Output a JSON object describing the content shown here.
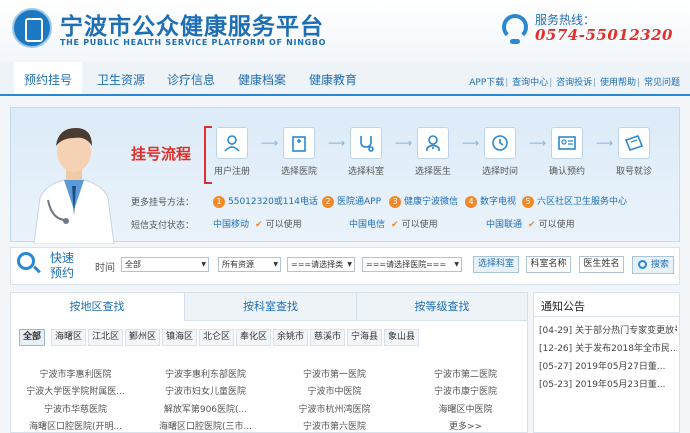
{
  "header": {
    "title": "宁波市公众健康服务平台",
    "subtitle": "THE PUBLIC HEALTH SERVICE PLATFORM OF NINGBO",
    "hotline_label": "服务热线：",
    "hotline_number": "0574-55012320"
  },
  "nav": {
    "items": [
      "预约挂号",
      "卫生资源",
      "诊疗信息",
      "健康档案",
      "健康教育"
    ],
    "quick_links": [
      "APP下载",
      "查询中心",
      "咨询投诉",
      "使用帮助",
      "常见问题"
    ]
  },
  "process": {
    "title": "挂号流程",
    "steps": [
      "用户注册",
      "选择医院",
      "选择科室",
      "选择医生",
      "选择时间",
      "确认预约",
      "取号就诊"
    ],
    "more_label": "更多挂号方法：",
    "methods": [
      {
        "num": "1",
        "text": "55012320或114电话"
      },
      {
        "num": "2",
        "text": "医院通APP"
      },
      {
        "num": "3",
        "text": "健康宁波微信"
      },
      {
        "num": "4",
        "text": "数字电视"
      },
      {
        "num": "5",
        "text": "六区社区卫生服务中心"
      }
    ],
    "sms_label": "短信支付状态：",
    "carriers": [
      {
        "name": "中国移动",
        "status": "可以使用"
      },
      {
        "name": "中国电信",
        "status": "可以使用"
      },
      {
        "name": "中国联通",
        "status": "可以使用"
      }
    ]
  },
  "quick_search": {
    "title": "快速预约",
    "time_label": "时间",
    "time_value": "全部",
    "resource_value": "所有资源",
    "type_value": "===请选择类",
    "hospital_value": "===请选择医院===",
    "dept_button": "选择科室",
    "dept_input": "科室名称",
    "doctor_input": "医生姓名",
    "search_button": "搜索"
  },
  "search_tabs": [
    "按地区查找",
    "按科室查找",
    "按等级查找"
  ],
  "districts": [
    "全部",
    "海曙区",
    "江北区",
    "鄞州区",
    "镇海区",
    "北仑区",
    "奉化区",
    "余姚市",
    "慈溪市",
    "宁海县",
    "象山县"
  ],
  "hospitals": [
    [
      "宁波市李惠利医院",
      "宁波李惠利东部医院",
      "宁波市第一医院",
      "宁波市第二医院"
    ],
    [
      "宁波大学医学院附属医...",
      "宁波市妇女儿童医院",
      "宁波市中医院",
      "宁波市康宁医院"
    ],
    [
      "宁波市华慈医院",
      "解放军第906医院(...",
      "宁波市杭州湾医院",
      "海曙区中医院"
    ],
    [
      "海曙区口腔医院(开明...",
      "海曙区口腔医院(三市...",
      "宁波市第六医院",
      "更多>>"
    ]
  ],
  "notices": {
    "title": "通知公告",
    "items": [
      {
        "date": "[04-29]",
        "text": "关于部分热门专家变更放号..."
      },
      {
        "date": "[12-26]",
        "text": "关于发布2018年全市民..."
      },
      {
        "date": "[05-27]",
        "text": "2019年05月27日董..."
      },
      {
        "date": "[05-23]",
        "text": "2019年05月23日董..."
      }
    ]
  }
}
